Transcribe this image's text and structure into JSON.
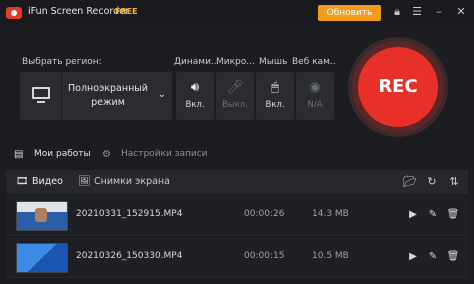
{
  "titlebar": {
    "app_name": "iFun Screen Recorder",
    "edition": "FREE",
    "upgrade_label": "Обновить",
    "icons": [
      "lock-icon",
      "menu-icon",
      "minimize-icon",
      "close-icon"
    ]
  },
  "region": {
    "label": "Выбрать регион:",
    "mode": "Полноэкранный режим"
  },
  "controls": [
    {
      "label": "Динами...",
      "state": "Вкл.",
      "icon": "speaker-icon",
      "enabled": true
    },
    {
      "label": "Микро...",
      "state": "Выкл.",
      "icon": "microphone-icon",
      "enabled": false
    },
    {
      "label": "Мышь",
      "state": "Вкл.",
      "icon": "mouse-icon",
      "enabled": true
    },
    {
      "label": "Веб кам...",
      "state": "N/A",
      "icon": "webcam-icon",
      "enabled": false
    }
  ],
  "rec_label": "REC",
  "works": {
    "my_works": "Мои работы",
    "settings": "Настройки записи"
  },
  "tabs": {
    "video": "Видео",
    "screenshots": "Снимки экрана"
  },
  "recordings": [
    {
      "name": "20210331_152915.MP4",
      "duration": "00:00:26",
      "size": "14.3 MB"
    },
    {
      "name": "20210326_150330.MP4",
      "duration": "00:00:15",
      "size": "10.5 MB"
    }
  ],
  "colors": {
    "accent": "#f49a1b",
    "rec": "#e8302a",
    "background": "#1c1d21"
  }
}
